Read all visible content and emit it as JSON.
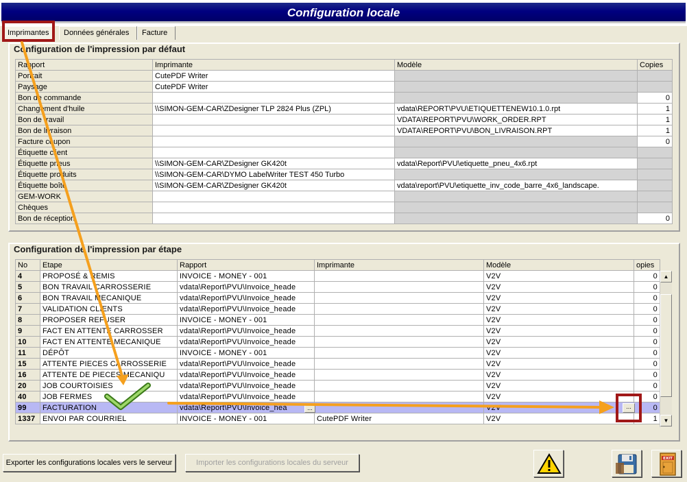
{
  "window": {
    "title": "Configuration locale"
  },
  "tabs": [
    {
      "label": "Imprimantes",
      "active": true
    },
    {
      "label": "Données générales",
      "active": false
    },
    {
      "label": "Facture",
      "active": false
    }
  ],
  "default_section": {
    "title": "Configuration de l'impression par défaut",
    "columns": [
      "Rapport",
      "Imprimante",
      "Modèle",
      "Copies"
    ],
    "rows": [
      {
        "rapport": "Portrait",
        "imprimante": "CutePDF Writer",
        "modele": "",
        "copies": ""
      },
      {
        "rapport": "Paysage",
        "imprimante": "CutePDF Writer",
        "modele": "",
        "copies": ""
      },
      {
        "rapport": "Bon de commande",
        "imprimante": "",
        "modele": "",
        "copies": "0"
      },
      {
        "rapport": "Changement d'huile",
        "imprimante": "\\\\SIMON-GEM-CAR\\ZDesigner TLP 2824 Plus (ZPL)",
        "modele": "vdata\\REPORT\\PVU\\ETIQUETTENEW10.1.0.rpt",
        "copies": "1"
      },
      {
        "rapport": "Bon de travail",
        "imprimante": "",
        "modele": "VDATA\\REPORT\\PVU\\WORK_ORDER.RPT",
        "copies": "1"
      },
      {
        "rapport": "Bon de livraison",
        "imprimante": "",
        "modele": "VDATA\\REPORT\\PVU\\BON_LIVRAISON.RPT",
        "copies": "1"
      },
      {
        "rapport": "Facture coupon",
        "imprimante": "",
        "modele": "",
        "copies": "0"
      },
      {
        "rapport": "Étiquette client",
        "imprimante": "",
        "modele": "",
        "copies": ""
      },
      {
        "rapport": "Étiquette pneus",
        "imprimante": "\\\\SIMON-GEM-CAR\\ZDesigner GK420t",
        "modele": "vdata\\Report\\PVU\\etiquette_pneu_4x6.rpt",
        "copies": ""
      },
      {
        "rapport": "Étiquette produits",
        "imprimante": "\\\\SIMON-GEM-CAR\\DYMO LabelWriter TEST 450 Turbo",
        "modele": "",
        "copies": ""
      },
      {
        "rapport": "Étiquette boîte",
        "imprimante": "\\\\SIMON-GEM-CAR\\ZDesigner GK420t",
        "modele": "vdata\\report\\PVU\\etiquette_inv_code_barre_4x6_landscape.",
        "copies": ""
      },
      {
        "rapport": "GEM-WORK",
        "imprimante": "",
        "modele": "",
        "copies": ""
      },
      {
        "rapport": "Chèques",
        "imprimante": "",
        "modele": "",
        "copies": ""
      },
      {
        "rapport": "Bon de réception",
        "imprimante": "",
        "modele": "",
        "copies": "0"
      }
    ]
  },
  "step_section": {
    "title": "Configuration de l'impression par étape",
    "columns": [
      "No",
      "Etape",
      "Rapport",
      "Imprimante",
      "Modèle",
      "opies"
    ],
    "rows": [
      {
        "no": "4",
        "etape": "PROPOSÉ & REMIS",
        "rapport": "INVOICE - MONEY - 001",
        "imprimante": "",
        "modele": "V2V",
        "copies": "0"
      },
      {
        "no": "5",
        "etape": "BON TRAVAIL CARROSSERIE",
        "rapport": "vdata\\Report\\PVU\\Invoice_heade",
        "imprimante": "",
        "modele": "V2V",
        "copies": "0"
      },
      {
        "no": "6",
        "etape": "BON TRAVAIL MECANIQUE",
        "rapport": "vdata\\Report\\PVU\\Invoice_heade",
        "imprimante": "",
        "modele": "V2V",
        "copies": "0"
      },
      {
        "no": "7",
        "etape": "VALIDATION CLIENTS",
        "rapport": "vdata\\Report\\PVU\\Invoice_heade",
        "imprimante": "",
        "modele": "V2V",
        "copies": "0"
      },
      {
        "no": "8",
        "etape": "PROPOSER REFUSER",
        "rapport": "INVOICE - MONEY - 001",
        "imprimante": "",
        "modele": "V2V",
        "copies": "0"
      },
      {
        "no": "9",
        "etape": "FACT EN ATTENTE CARROSSER",
        "rapport": "vdata\\Report\\PVU\\Invoice_heade",
        "imprimante": "",
        "modele": "V2V",
        "copies": "0"
      },
      {
        "no": "10",
        "etape": "FACT EN ATTENTE MECANIQUE",
        "rapport": "vdata\\Report\\PVU\\Invoice_heade",
        "imprimante": "",
        "modele": "V2V",
        "copies": "0"
      },
      {
        "no": "11",
        "etape": "DÉPÔT",
        "rapport": "INVOICE - MONEY - 001",
        "imprimante": "",
        "modele": "V2V",
        "copies": "0"
      },
      {
        "no": "15",
        "etape": "ATTENTE PIECES CARROSSERIE",
        "rapport": "vdata\\Report\\PVU\\Invoice_heade",
        "imprimante": "",
        "modele": "V2V",
        "copies": "0"
      },
      {
        "no": "16",
        "etape": "ATTENTE DE PIECES MECANIQU",
        "rapport": "vdata\\Report\\PVU\\Invoice_heade",
        "imprimante": "",
        "modele": "V2V",
        "copies": "0"
      },
      {
        "no": "20",
        "etape": "JOB COURTOISIES",
        "rapport": "vdata\\Report\\PVU\\Invoice_heade",
        "imprimante": "",
        "modele": "V2V",
        "copies": "0"
      },
      {
        "no": "40",
        "etape": "JOB FERMES",
        "rapport": "vdata\\Report\\PVU\\Invoice_heade",
        "imprimante": "",
        "modele": "V2V",
        "copies": "0"
      },
      {
        "no": "99",
        "etape": "FACTURATION",
        "rapport": "vdata\\Report\\PVU\\Invoice_hea",
        "imprimante": "",
        "modele": "V2V",
        "copies": "0",
        "selected": true
      },
      {
        "no": "1337",
        "etape": "ENVOI PAR COURRIEL",
        "rapport": "INVOICE - MONEY - 001",
        "imprimante": "CutePDF Writer",
        "modele": "V2V",
        "copies": "1"
      }
    ],
    "cell_button_label": "..."
  },
  "footer": {
    "export_label": "Exporter les configurations locales vers le serveur",
    "import_label": "Importer les configurations locales du serveur",
    "exit_label": "EXIT"
  },
  "scrollbar": {
    "up_glyph": "▲",
    "down_glyph": "▼"
  },
  "colors": {
    "annotation_arrow": "#f5a01e",
    "highlight_box": "#a01818",
    "selected_row": "#b8b8f4",
    "title_bar": "#000080"
  },
  "icons": [
    "warning-icon",
    "save-disk-icon",
    "exit-door-icon",
    "checkmark-icon"
  ]
}
